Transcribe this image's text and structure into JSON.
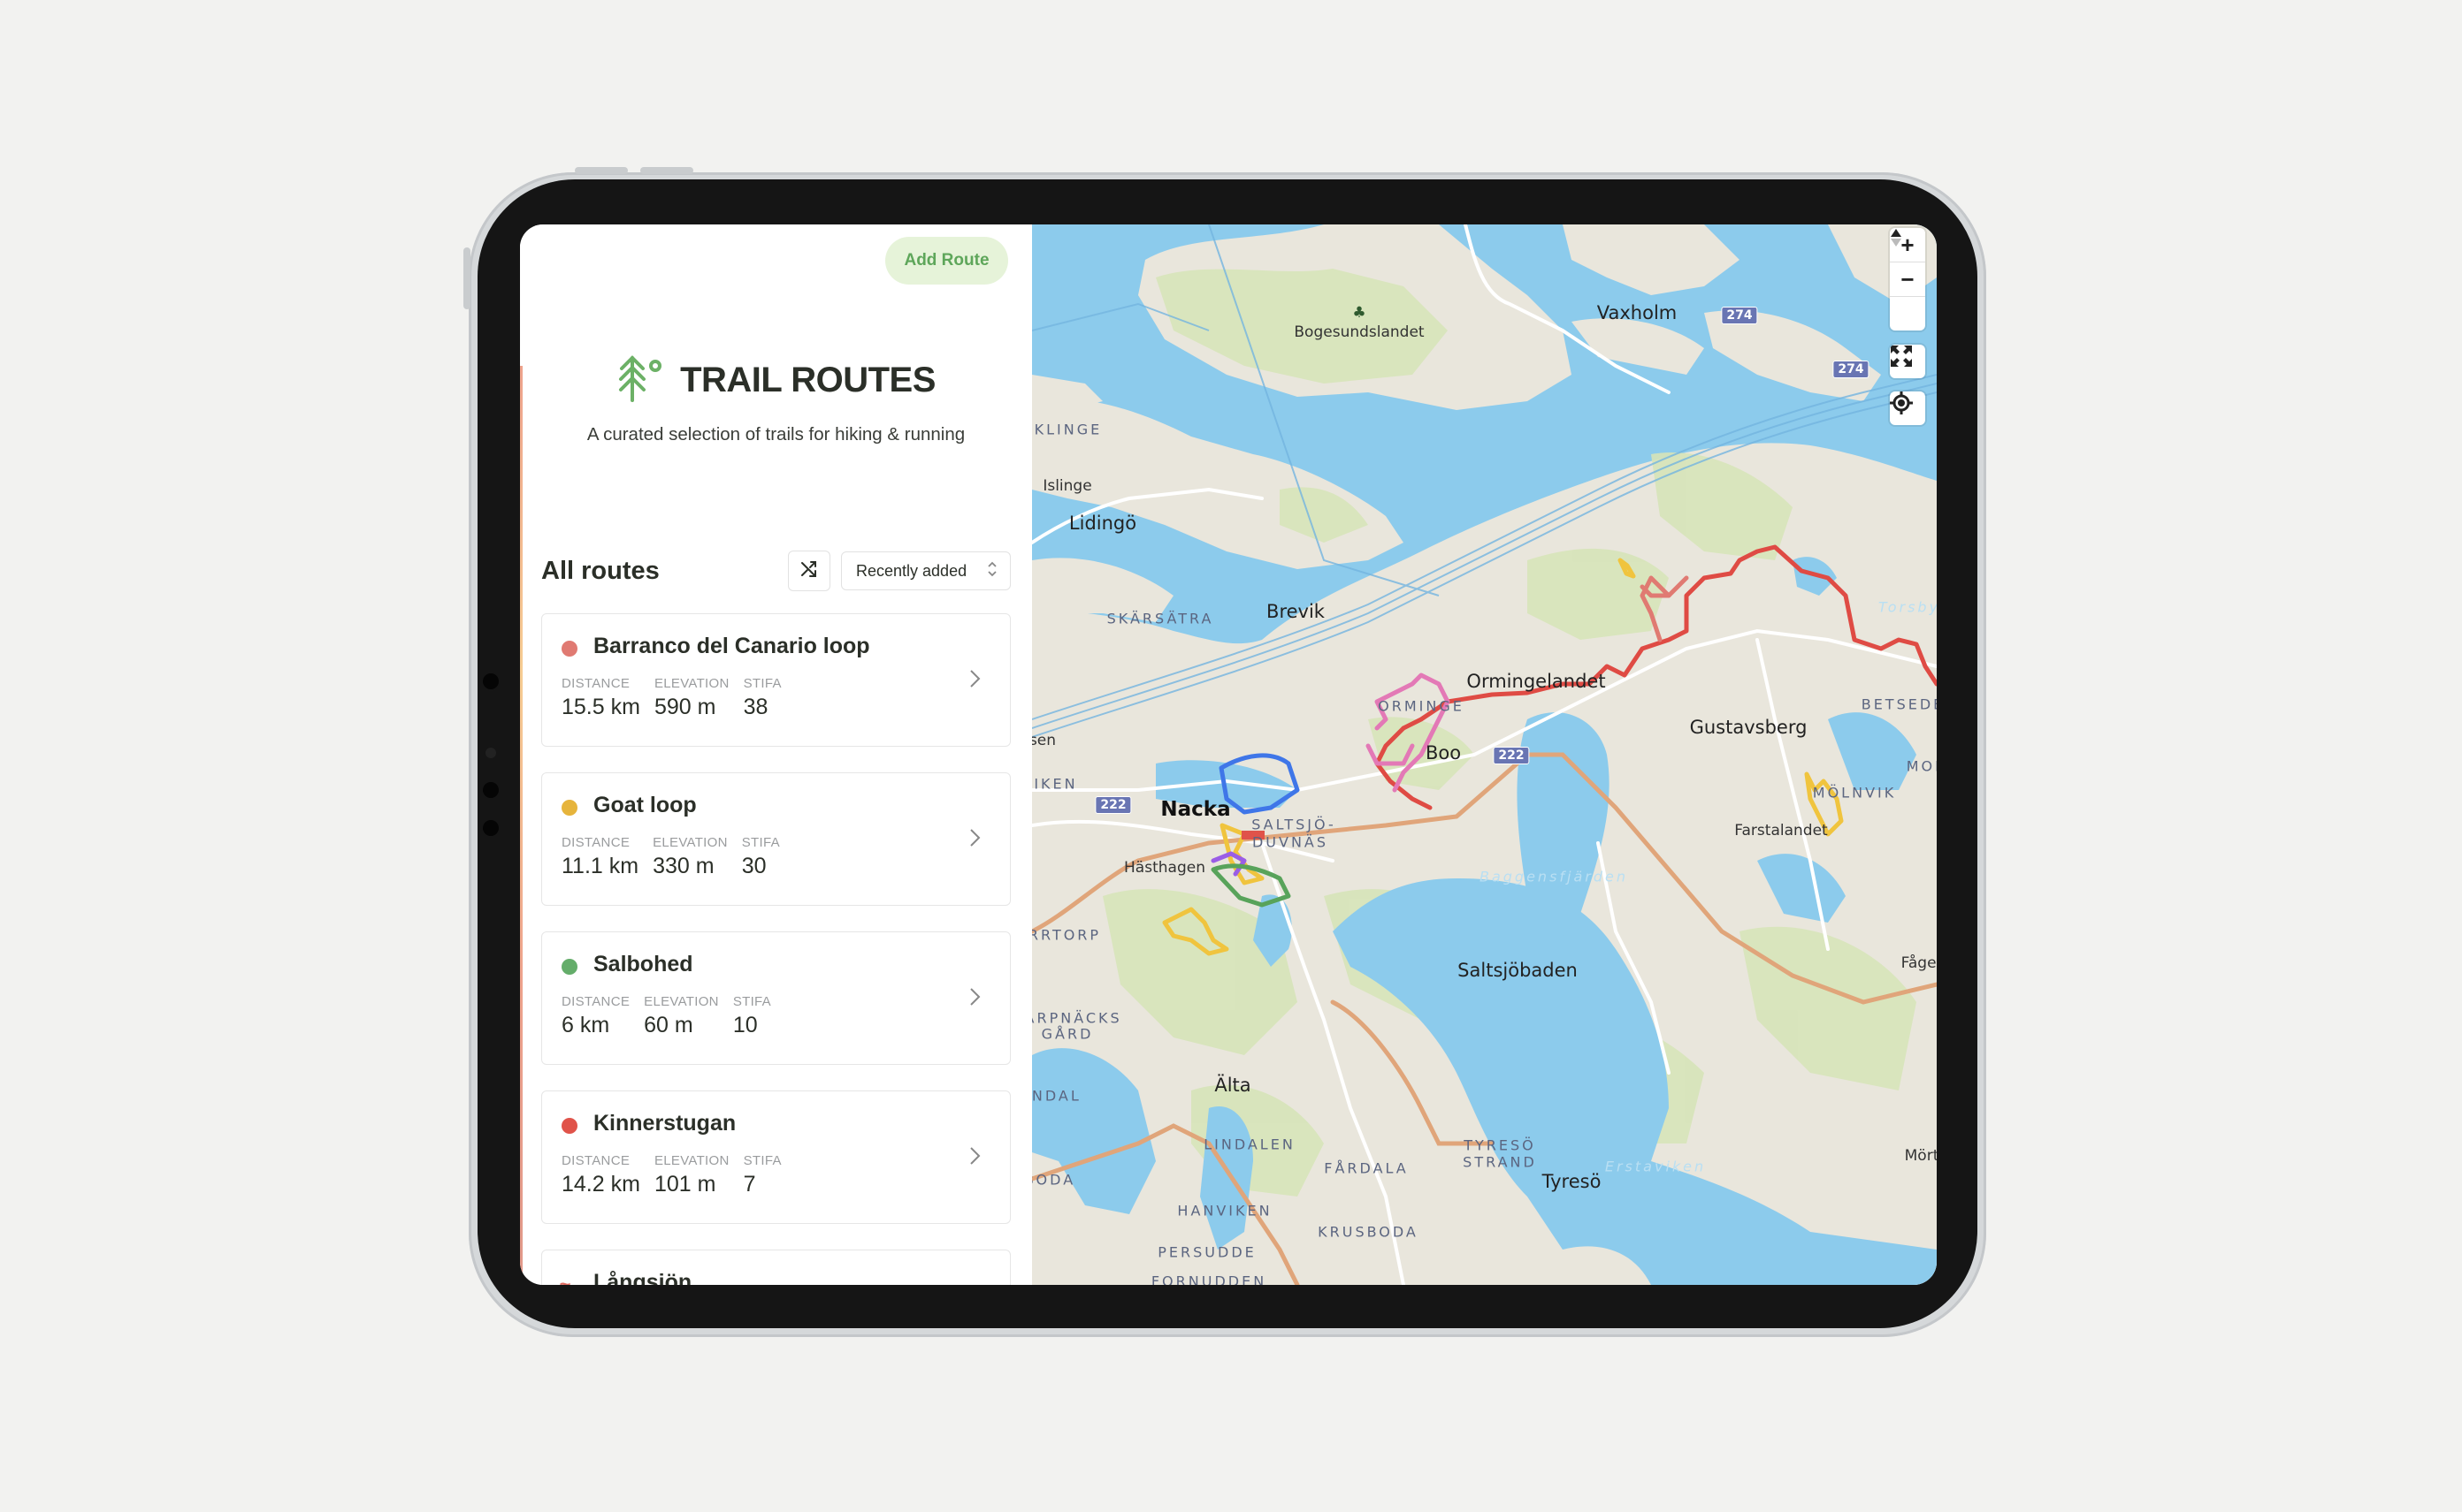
{
  "app": {
    "add_route_label": "Add Route",
    "title": "TRAIL ROUTES",
    "tagline": "A curated selection of trails for hiking & running",
    "logo_icon": "tree-icon",
    "accent_color": "#5ea65a"
  },
  "routes_section": {
    "title": "All routes",
    "shuffle_icon": "shuffle-icon",
    "sort": {
      "selected": "Recently added"
    },
    "stat_labels": {
      "distance": "DISTANCE",
      "elevation": "ELEVATION",
      "stifa": "STIFA"
    }
  },
  "routes": [
    {
      "name": "Barranco del Canario loop",
      "color": "#e07a72",
      "distance": "15.5 km",
      "elevation": "590 m",
      "stifa": "38"
    },
    {
      "name": "Goat loop",
      "color": "#e6b43c",
      "distance": "11.1 km",
      "elevation": "330 m",
      "stifa": "30"
    },
    {
      "name": "Salbohed",
      "color": "#64ad6a",
      "distance": "6 km",
      "elevation": "60 m",
      "stifa": "10"
    },
    {
      "name": "Kinnerstugan",
      "color": "#e0534a",
      "distance": "14.2 km",
      "elevation": "101 m",
      "stifa": "7"
    },
    {
      "name": "Långsjön",
      "color": "#e06a60",
      "icon": "≈"
    }
  ],
  "map": {
    "controls": {
      "zoom_in": "+",
      "zoom_out": "−",
      "compass": "compass-icon",
      "fullscreen": "fullscreen-icon",
      "locate": "locate-icon"
    },
    "labels": {
      "bogesundslandet": "Bogesundslandet",
      "vaxholm": "Vaxholm",
      "icklinge": "ICKLINGE",
      "islinge": "Islinge",
      "lidingo": "Lidingö",
      "skarsatra": "SKÄRSÄTRA",
      "brevik": "Brevik",
      "orminge": "ORMINGE",
      "ormingelandet": "Ormingelandet",
      "boo": "Boo",
      "gustavsberg": "Gustavsberg",
      "betsede": "BETSEDE",
      "mor": "MOR",
      "molnvik": "MÖLNVIK",
      "farstalandet": "Farstalandet",
      "nacka": "Nacka",
      "saltsjo": "SALTSJÖ-",
      "duvnas": "DUVNÄS",
      "hasthagen": "Hästhagen",
      "viken": "VIKEN",
      "sen": "sen",
      "arrtorp": "ARRTORP",
      "karpnacks": "KARPNÄCKS",
      "gard": "GÅRD",
      "baggensfjarden": "Baggensfjärden",
      "saltsjobaden": "Saltsjöbaden",
      "fagelv": "Fågelv",
      "alta": "Älta",
      "ondal": "ÖNDAL",
      "lindalen": "LINDALEN",
      "fardala": "FÅRDALA",
      "tyreso_strand_1": "TYRESÖ",
      "tyreso_strand_2": "STRAND",
      "tyreso": "Tyresö",
      "erstaviken": "Erstaviken",
      "mort": "Mört",
      "hanviken": "HANVIKEN",
      "krusboda": "KRUSBODA",
      "boda": "BODA",
      "persudde": "PERSUDDE",
      "fornudden": "FORNUDDEN",
      "torsbyfjarden": "Torsbyfj"
    },
    "road_badges": {
      "r222": "222",
      "r274": "274"
    },
    "colors": {
      "water": "#8ccbec",
      "land": "#e8e6dc",
      "forest": "#d6e4b8",
      "road_major": "#e0a57a"
    }
  }
}
